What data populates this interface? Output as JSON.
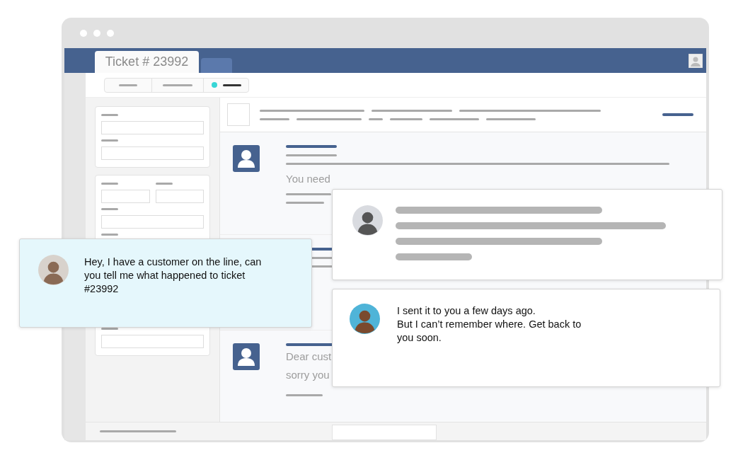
{
  "tabs": [
    {
      "label": "Ticket # 23992",
      "selected": true
    },
    {
      "selected": false
    }
  ],
  "view_switcher": [
    {
      "selected": false
    },
    {
      "selected": false
    },
    {
      "selected": true
    }
  ],
  "messages": [
    {
      "lines": [
        "You need"
      ]
    },
    {
      "lines": [
        "Dear cust",
        "sorry you"
      ]
    }
  ],
  "chat_cards": [
    {
      "kind": "text",
      "text": "Hey, I have a customer on the line, can\nyou tell me what happened to ticket\n#23992"
    },
    {
      "kind": "skeleton"
    },
    {
      "kind": "text",
      "text": "I sent it to you a few days ago.\nBut I can’t remember where. Get back to\nyou soon."
    }
  ]
}
